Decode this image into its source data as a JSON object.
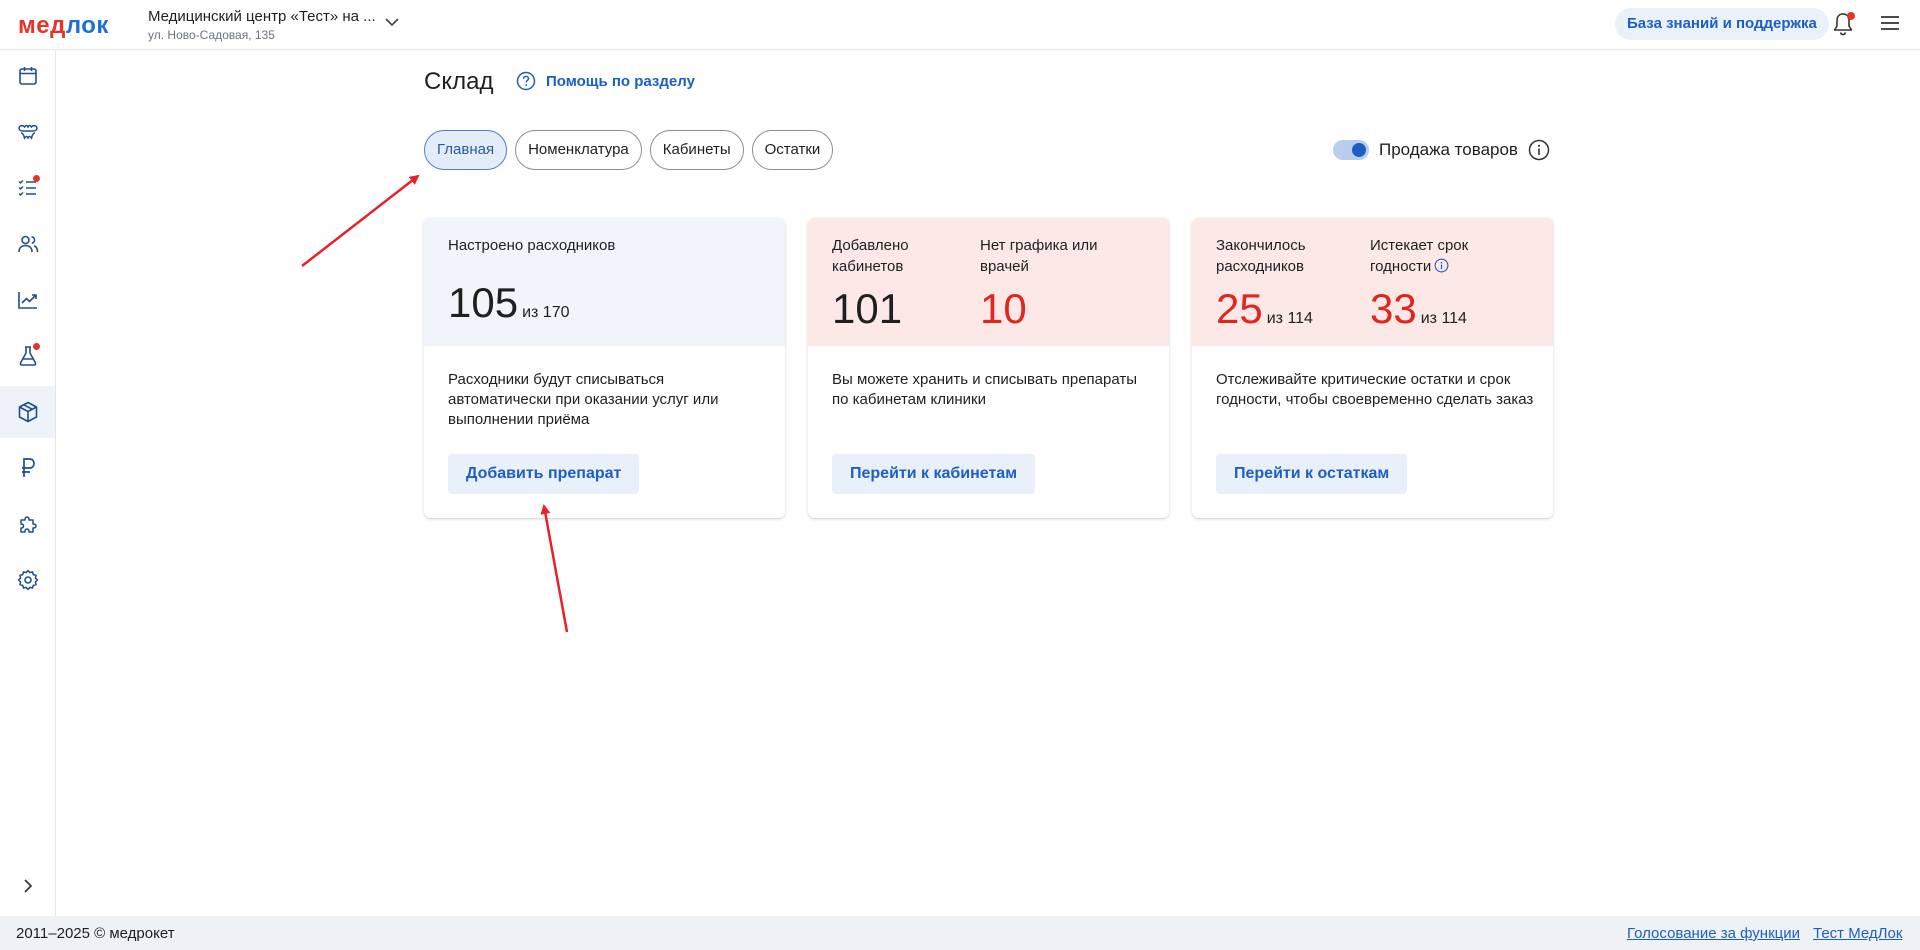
{
  "header": {
    "logo_part1": "мед",
    "logo_part2": "лок",
    "clinic_name": "Медицинский центр «Тест» на ...",
    "clinic_address": "ул. Ново-Садовая, 135",
    "knowledge_base_label": "База знаний и поддержка"
  },
  "sidebar": {
    "items": [
      {
        "icon": "calendar-icon"
      },
      {
        "icon": "teeth-icon"
      },
      {
        "icon": "checklist-icon",
        "badge": true
      },
      {
        "icon": "users-icon"
      },
      {
        "icon": "chart-line-icon"
      },
      {
        "icon": "flask-icon",
        "badge": true
      },
      {
        "icon": "box-icon",
        "active": true
      },
      {
        "icon": "ruble-icon"
      },
      {
        "icon": "puzzle-icon"
      },
      {
        "icon": "gear-icon"
      }
    ]
  },
  "page": {
    "title": "Склад",
    "help_label": "Помощь по разделу"
  },
  "tabs": [
    {
      "label": "Главная",
      "active": true
    },
    {
      "label": "Номенклатура"
    },
    {
      "label": "Кабинеты"
    },
    {
      "label": "Остатки"
    }
  ],
  "toggle": {
    "label": "Продажа товаров",
    "on": true
  },
  "cards": [
    {
      "stats": [
        {
          "label": "Настроено расходников",
          "value": "105",
          "of": "из 170"
        }
      ],
      "description": "Расходники будут списываться автоматически при оказании услуг или выполнении приёма",
      "button": "Добавить препарат"
    },
    {
      "stats": [
        {
          "label": "Добавлено кабинетов",
          "value": "101"
        },
        {
          "label": "Нет графика или врачей",
          "value": "10"
        }
      ],
      "description": "Вы можете хранить и списывать препараты по кабинетам клиники",
      "button": "Перейти к кабинетам"
    },
    {
      "stats": [
        {
          "label": "Закончилось расходников",
          "value": "25",
          "of": "из 114"
        },
        {
          "label": "Истекает срок годности",
          "value": "33",
          "of": "из 114"
        }
      ],
      "description": "Отслеживайте критические остатки и срок годности, чтобы своевременно сделать заказ",
      "button": "Перейти к остаткам"
    }
  ],
  "footer": {
    "copyright": "2011–2025 © медрокет",
    "link_vote": "Голосование за функции",
    "link_test": "Тест МедЛок"
  },
  "colors": {
    "accent": "#1c5fc3",
    "danger": "#e0261d",
    "annotation_arrow": "#e8202a"
  }
}
